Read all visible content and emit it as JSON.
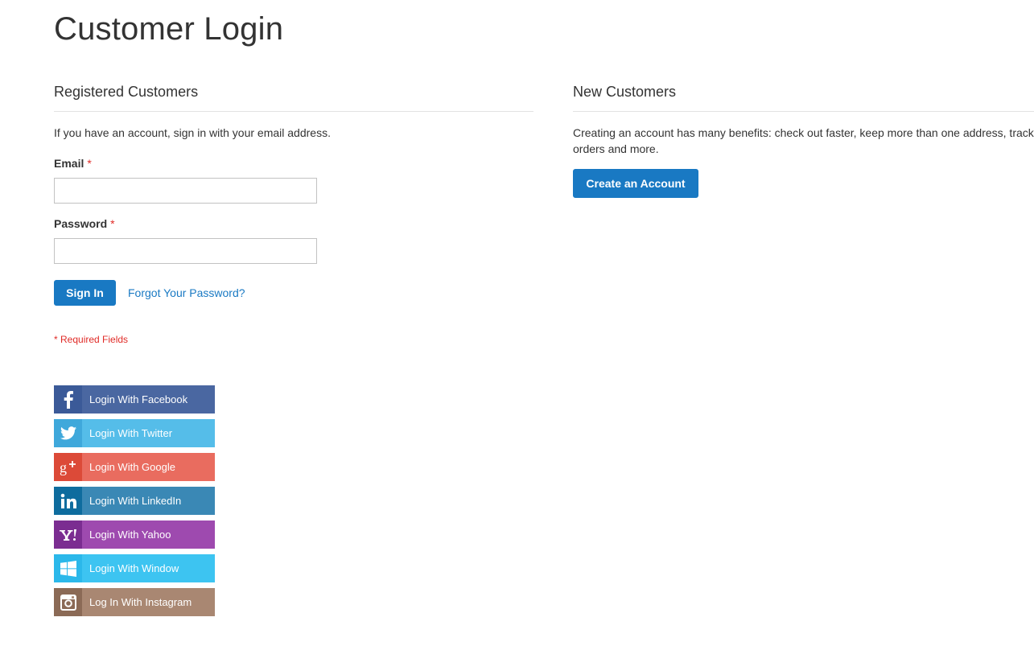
{
  "page": {
    "title": "Customer Login"
  },
  "registered": {
    "title": "Registered Customers",
    "intro": "If you have an account, sign in with your email address.",
    "email_label": "Email",
    "password_label": "Password",
    "required_mark": "*",
    "email_value": "",
    "password_value": "",
    "sign_in_label": "Sign In",
    "forgot_label": "Forgot Your Password?",
    "required_note": "* Required Fields"
  },
  "new_customers": {
    "title": "New Customers",
    "intro": "Creating an account has many benefits: check out faster, keep more than one address, track orders and more.",
    "create_label": "Create an Account"
  },
  "social_logins": [
    {
      "label": "Login With Facebook",
      "icon": "facebook-icon",
      "icon_bg": "#3b5a98",
      "bg": "#4a67a1"
    },
    {
      "label": "Login With Twitter",
      "icon": "twitter-icon",
      "icon_bg": "#3fa8db",
      "bg": "#55bde9"
    },
    {
      "label": "Login With Google",
      "icon": "google-plus-icon",
      "icon_bg": "#dc4a38",
      "bg": "#e96c5f"
    },
    {
      "label": "Login With LinkedIn",
      "icon": "linkedin-icon",
      "icon_bg": "#0e6c9e",
      "bg": "#3a88b5"
    },
    {
      "label": "Login With Yahoo",
      "icon": "yahoo-icon",
      "icon_bg": "#7b2d91",
      "bg": "#9e4aaf"
    },
    {
      "label": "Login With Window",
      "icon": "windows-icon",
      "icon_bg": "#2bb8ea",
      "bg": "#3dc4f1"
    },
    {
      "label": "Log In With Instagram",
      "icon": "instagram-icon",
      "icon_bg": "#8b6a56",
      "bg": "#a98772"
    }
  ],
  "colors": {
    "accent": "#1979c3",
    "required": "#e02b27"
  }
}
